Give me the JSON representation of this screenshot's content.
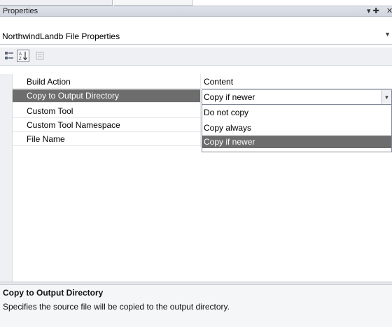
{
  "panel": {
    "title": "Properties",
    "pin_glyph": "▾ ✚",
    "close_glyph": "✕"
  },
  "object_selector": {
    "value": "NorthwindLandb File Properties"
  },
  "toolbar": {
    "buttons": [
      {
        "name": "categorized",
        "icon": "categorized-icon",
        "selected": false
      },
      {
        "name": "alphabetical",
        "icon": "sort-az-icon",
        "selected": true
      },
      {
        "name": "property-pages",
        "icon": "property-pages-icon",
        "selected": false
      }
    ]
  },
  "properties": [
    {
      "name": "Build Action",
      "value": "Content"
    },
    {
      "name": "Copy to Output Directory",
      "value": "Copy if newer",
      "selected": true
    },
    {
      "name": "Custom Tool",
      "value": ""
    },
    {
      "name": "Custom Tool Namespace",
      "value": ""
    },
    {
      "name": "File Name",
      "value": ""
    }
  ],
  "editor": {
    "value": "Copy if newer",
    "dropdown_glyph": "▼"
  },
  "dropdown": {
    "options": [
      "Do not copy",
      "Copy always",
      "Copy if newer"
    ],
    "highlighted_index": 2
  },
  "description": {
    "title": "Copy to Output Directory",
    "text": "Specifies the source file will be copied to the output directory."
  },
  "colors": {
    "selection": "#6d6d6d",
    "titlebar": "#d8dce3",
    "gutter": "#eef0f3"
  }
}
